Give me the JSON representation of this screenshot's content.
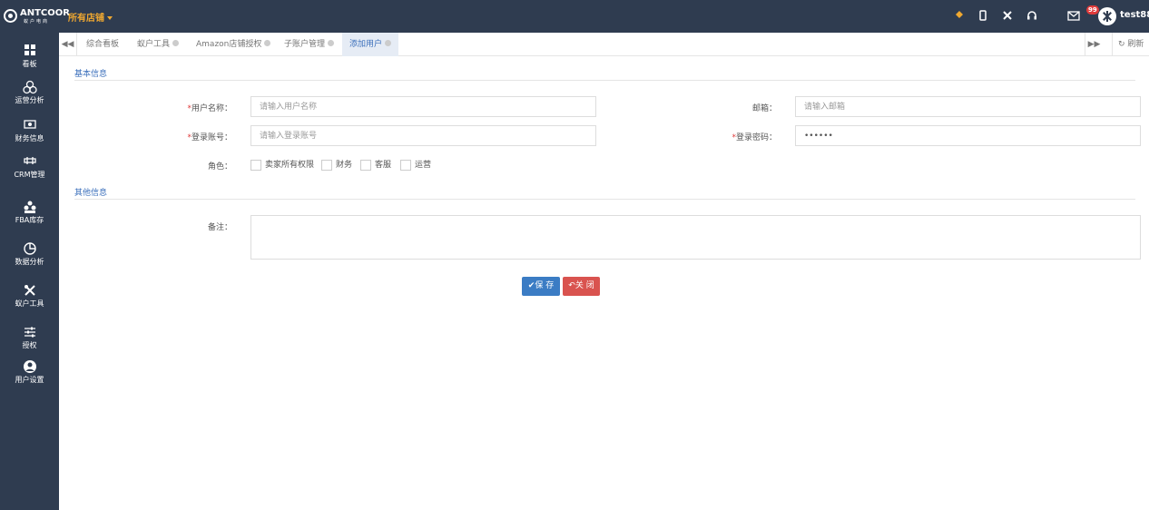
{
  "header": {
    "brand": "ANTCOOR",
    "brand_sub": "蚁户电商",
    "store_select": "所有店铺",
    "mail_badge": "99",
    "username": "test88"
  },
  "sidebar": {
    "items": [
      {
        "label": "看板",
        "icon": "dashboard-icon"
      },
      {
        "label": "运营分析",
        "icon": "operations-icon"
      },
      {
        "label": "财务信息",
        "icon": "finance-icon"
      },
      {
        "label": "CRM管理",
        "icon": "crm-icon"
      },
      {
        "label": "FBA库存",
        "icon": "inventory-icon"
      },
      {
        "label": "数据分析",
        "icon": "pie-chart-icon"
      },
      {
        "label": "蚁户工具",
        "icon": "tools-icon"
      },
      {
        "label": "授权",
        "icon": "sliders-icon"
      },
      {
        "label": "用户设置",
        "icon": "user-icon"
      }
    ]
  },
  "tabs": {
    "items": [
      "综合看板",
      "蚁户工具",
      "Amazon店铺授权",
      "子账户管理",
      "添加用户"
    ],
    "active": "添加用户",
    "refresh": "刷新"
  },
  "form": {
    "section_basic": "基本信息",
    "section_other": "其他信息",
    "username_label": "用户名称：",
    "username_placeholder": "请输入用户名称",
    "email_label": "邮箱：",
    "email_placeholder": "请输入邮箱",
    "account_label": "登录账号：",
    "account_placeholder": "请输入登录账号",
    "password_label": "登录密码：",
    "password_value": "••••••",
    "role_label": "角色：",
    "roles": [
      "卖家所有权限",
      "财务",
      "客服",
      "运营"
    ],
    "remark_label": "备注：",
    "save_label": "✔保 存",
    "close_label": "↶关 闭"
  },
  "colors": {
    "nav_bg": "#2f3c50",
    "accent": "#3b6fbb",
    "store": "#f0a830",
    "save": "#3b7cc4",
    "close": "#d9534f"
  }
}
